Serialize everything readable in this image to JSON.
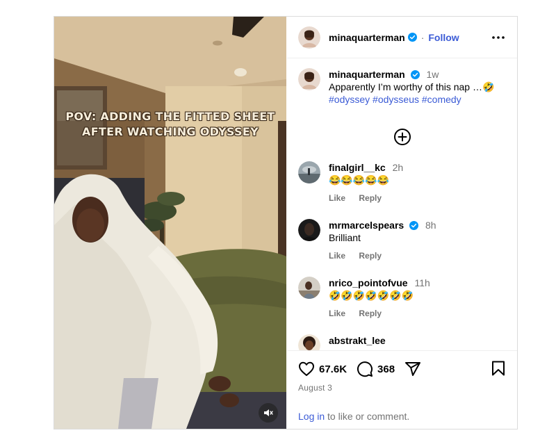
{
  "post": {
    "author": {
      "username": "minaquarterman",
      "verified": true,
      "follow_label": "Follow",
      "dot": "·"
    },
    "caption": {
      "username": "minaquarterman",
      "time": "1w",
      "text": "Apparently I’m worthy of this nap …🤣",
      "hashtags": [
        "#odyssey",
        "#odysseus",
        "#comedy"
      ]
    },
    "video_overlay_text": [
      "POV: ADDING THE FITTED SHEET",
      "AFTER WATCHING ODYSSEY"
    ],
    "view_replies_icon": "plus-circle-icon",
    "comments": [
      {
        "username": "finalgirl__kc",
        "verified": false,
        "time": "2h",
        "text": "😂😂😂😂😂",
        "like_label": "Like",
        "reply_label": "Reply"
      },
      {
        "username": "mrmarcelspears",
        "verified": true,
        "time": "8h",
        "text": "Brilliant",
        "like_label": "Like",
        "reply_label": "Reply"
      },
      {
        "username": "nrico_pointofvue",
        "verified": false,
        "time": "11h",
        "text": "🤣🤣🤣🤣🤣🤣🤣",
        "like_label": "Like",
        "reply_label": "Reply"
      },
      {
        "username": "abstrakt_lee",
        "verified": false,
        "time": "",
        "text": "",
        "like_label": "",
        "reply_label": ""
      }
    ],
    "likes": "67.6K",
    "comments_count": "368",
    "date": "August 3",
    "login_prompt": {
      "link": "Log in",
      "rest": " to like or comment."
    },
    "colors": {
      "link_blue": "#3b5bd6",
      "verified_blue": "#0095f6",
      "muted": "#737373",
      "border": "#dbdbdb"
    }
  }
}
